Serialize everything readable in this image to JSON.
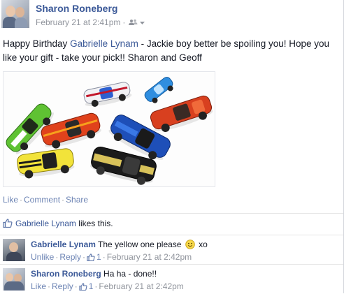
{
  "post": {
    "author": "Sharon Roneberg",
    "timestamp": "February 21 at 2:41pm",
    "audience_icon": "friends-icon",
    "text_before": "Happy Birthday ",
    "tagged_name": "Gabrielle Lynam",
    "text_after": " - Jackie boy better be spoiling you! Hope you like your gift - take your pick!! Sharon and Geoff",
    "photo_icon": "toy-cars-photo",
    "actions": {
      "like": "Like",
      "comment": "Comment",
      "share": "Share",
      "separator": "·"
    },
    "likes": {
      "name": "Gabrielle Lynam",
      "suffix": " likes this."
    }
  },
  "comments": [
    {
      "author": "Gabrielle Lynam",
      "text_before": " The yellow one please ",
      "emoji": "smiley-icon",
      "text_after": " xo",
      "action": "Unlike",
      "reply": "Reply",
      "like_count": "1",
      "timestamp": "February 21 at 2:42pm"
    },
    {
      "author": "Sharon Roneberg",
      "text": " Ha ha - done!!",
      "action": "Like",
      "reply": "Reply",
      "like_count": "1",
      "timestamp": "February 21 at 2:42pm"
    }
  ],
  "colors": {
    "link": "#3b5998",
    "action_link": "#6d84b4",
    "meta_gray": "#90949c"
  }
}
